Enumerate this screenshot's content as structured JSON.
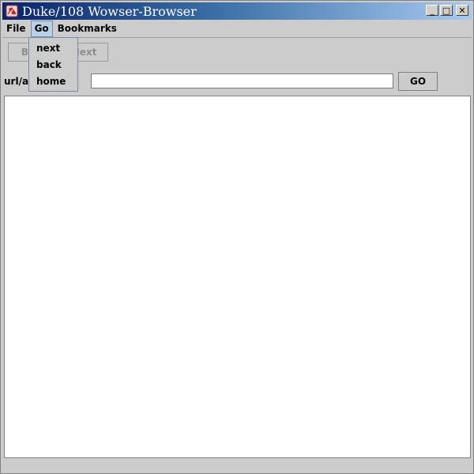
{
  "window": {
    "title": "Duke/108 Wowser-Browser",
    "controls": {
      "minimize": "_",
      "maximize": "□",
      "close": "✕"
    }
  },
  "menubar": {
    "items": [
      {
        "label": "File"
      },
      {
        "label": "Go"
      },
      {
        "label": "Bookmarks"
      }
    ]
  },
  "go_menu": {
    "items": [
      {
        "label": "next"
      },
      {
        "label": "back"
      },
      {
        "label": "home"
      }
    ]
  },
  "toolbar": {
    "back_label": "Back",
    "next_label": "Next"
  },
  "address": {
    "label": "url/address",
    "value": "",
    "go_label": "GO"
  },
  "colors": {
    "title_bar_start": "#0a246a",
    "title_bar_end": "#a6caf0",
    "window_bg": "#cccccc",
    "menu_highlight": "#b8cfe5"
  },
  "icons": {
    "app": "duke-icon"
  }
}
